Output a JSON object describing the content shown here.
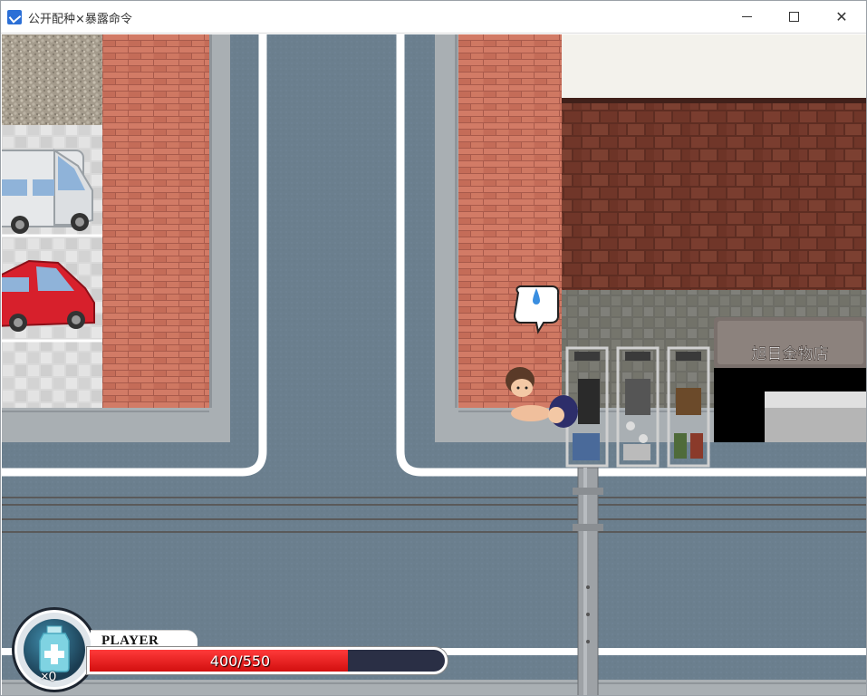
{
  "window": {
    "title": "公开配种×暴露命令",
    "icon": "app-icon",
    "controls": [
      "minimize-icon",
      "maximize-icon",
      "close-icon"
    ]
  },
  "scene": {
    "shop_sign": "旭日金物店",
    "speech_bubble_icon": "sweat-drop-icon",
    "colors": {
      "road": "#6b7f8e",
      "sidewalk_brick": "#c8705e",
      "curb": "#aeb4b9",
      "lane_line": "#ffffff",
      "roof_tile": "#6a3528",
      "white_van": "#e6e8ea",
      "red_car": "#d7202c"
    }
  },
  "hud": {
    "player_label": "PLAYER",
    "potion_count": "×0",
    "potion_icon": "potion-bottle-icon",
    "hp": {
      "current": 400,
      "max": 550,
      "text": "400/550"
    },
    "colors": {
      "hp_fill": "#e01818",
      "hp_empty": "#2a2f45"
    }
  }
}
